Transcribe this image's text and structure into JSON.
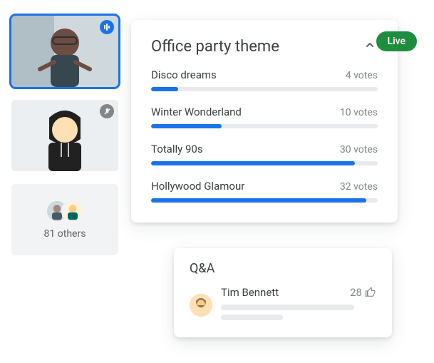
{
  "participants": {
    "tile1_status": "speaking",
    "tile2_status": "muted",
    "others_count_label": "81 others"
  },
  "live_badge": "Live",
  "poll": {
    "title": "Office party theme",
    "collapse_icon": "chevron-up",
    "options": [
      {
        "name": "Disco dreams",
        "votes_label": "4 votes",
        "pct": 12
      },
      {
        "name": "Winter Wonderland",
        "votes_label": "10 votes",
        "pct": 31
      },
      {
        "name": "Totally 90s",
        "votes_label": "30 votes",
        "pct": 90
      },
      {
        "name": "Hollywood Glamour",
        "votes_label": "32 votes",
        "pct": 95
      }
    ]
  },
  "qa": {
    "title": "Q&A",
    "item": {
      "name": "Tim Bennett",
      "upvotes": "28"
    }
  },
  "chart_data": {
    "type": "bar",
    "title": "Office party theme",
    "categories": [
      "Disco dreams",
      "Winter Wonderland",
      "Totally 90s",
      "Hollywood Glamour"
    ],
    "values": [
      4,
      10,
      30,
      32
    ],
    "xlabel": "",
    "ylabel": "votes",
    "ylim": [
      0,
      35
    ]
  }
}
